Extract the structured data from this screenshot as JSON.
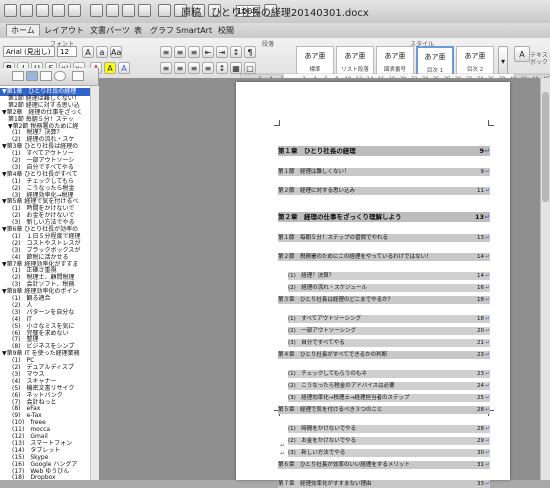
{
  "window": {
    "title": "原稿　ひとり社長の経理20140301.docx",
    "zoom": "100%"
  },
  "ribbon": {
    "tabs": [
      "ホーム",
      "レイアウト",
      "文書パーツ",
      "表",
      "グラフ",
      "SmartArt",
      "校閲"
    ],
    "active_tab": "ホーム",
    "group_labels": {
      "font": "フォント",
      "paragraph": "段落",
      "styles": "スタイル"
    },
    "font_name": "Arial (見出し)",
    "font_size": "12",
    "style_tiles": [
      {
        "preview": "あア亜",
        "label": "標準"
      },
      {
        "preview": "あア亜",
        "label": "リスト段落"
      },
      {
        "preview": "あア亜",
        "label": "図表番号"
      },
      {
        "preview": "あア亜",
        "label": "目次 1"
      },
      {
        "preview": "あア亜",
        "label": "目次 2"
      }
    ],
    "right_label": "テキスト\nボック",
    "format_buttons": [
      "B",
      "I",
      "U",
      "A",
      "A",
      "A"
    ]
  },
  "ruler": {
    "ticks": [
      "6",
      "4",
      "2",
      "",
      "2",
      "4",
      "6",
      "8",
      "10",
      "12",
      "14",
      "16",
      "18",
      "20",
      "22",
      "24",
      "26",
      "28",
      "30",
      "32",
      "34",
      "36",
      "38",
      "40",
      "42",
      "44",
      "46",
      "48"
    ]
  },
  "sidebar": {
    "items": [
      {
        "text": "▼第1章　ひとり社長の経理",
        "level": 0,
        "selected": true
      },
      {
        "text": "第1節 経理は難しくない！",
        "level": 1
      },
      {
        "text": "第2節 経理に対する思い込",
        "level": 1
      },
      {
        "text": "▼第2章　経理の仕事をざっく",
        "level": 0
      },
      {
        "text": "第1節 毎朝５分！ステッ",
        "level": 1
      },
      {
        "text": "▼第2節 税務署のために経",
        "level": 1
      },
      {
        "text": "(1)　税理？決算？",
        "level": 2
      },
      {
        "text": "(2)　経理の流れ・スケ",
        "level": 2
      },
      {
        "text": "▼第3章 ひとり社長は経理の",
        "level": 0
      },
      {
        "text": "(1)　すべてアウトソー",
        "level": 2
      },
      {
        "text": "(2)　一部アウトソーシ",
        "level": 2
      },
      {
        "text": "(3)　自分ですべてやる",
        "level": 2
      },
      {
        "text": "▼第4章 ひとり社長がすべて",
        "level": 0
      },
      {
        "text": "(1)　チェックしてもら",
        "level": 2
      },
      {
        "text": "(2)　こうなったら税金",
        "level": 2
      },
      {
        "text": "(3)　経理効率化→税理",
        "level": 2
      },
      {
        "text": "▼第5章 経理で気を付けるべ",
        "level": 0
      },
      {
        "text": "(1)　時間をかけないで",
        "level": 2
      },
      {
        "text": "(2)　お金をかけないで",
        "level": 2
      },
      {
        "text": "(3)　新しい方法でやる",
        "level": 2
      },
      {
        "text": "▼第6章 ひとり社長が効率の",
        "level": 0
      },
      {
        "text": "(1)　１日５分程度で経理",
        "level": 2
      },
      {
        "text": "(2)　コストやストレスが",
        "level": 2
      },
      {
        "text": "(3)　ブラックボックスが",
        "level": 2
      },
      {
        "text": "(4)　節税に活かせる",
        "level": 2
      },
      {
        "text": "▼第7章 経理効率化がすすま",
        "level": 0
      },
      {
        "text": "(1)　正確さ重視",
        "level": 2
      },
      {
        "text": "(2)　税理士、顧問税理",
        "level": 2
      },
      {
        "text": "(3)　会計ソフト、税務",
        "level": 2
      },
      {
        "text": "▼第8章 経理効率化のポイン",
        "level": 0
      },
      {
        "text": "(1)　観る適合",
        "level": 2
      },
      {
        "text": "(2)　人",
        "level": 2
      },
      {
        "text": "(3)　パターンを自分な",
        "level": 2
      },
      {
        "text": "(4)　IT",
        "level": 2
      },
      {
        "text": "(5)　小さなミスを気に",
        "level": 2
      },
      {
        "text": "(6)　完璧を求めない",
        "level": 2
      },
      {
        "text": "(7)　整理",
        "level": 2
      },
      {
        "text": "(8)　ビジネスをシンプ",
        "level": 2
      },
      {
        "text": "▼第9章 IT を使った経理業務",
        "level": 0
      },
      {
        "text": "(1)　PC",
        "level": 2
      },
      {
        "text": "(2)　デュアルディスプ",
        "level": 2
      },
      {
        "text": "(3)　マウス",
        "level": 2
      },
      {
        "text": "(4)　スキャナー",
        "level": 2
      },
      {
        "text": "(5)　機密文書リサイク",
        "level": 2
      },
      {
        "text": "(6)　ネットバンク",
        "level": 2
      },
      {
        "text": "(7)　会計ねっと",
        "level": 2
      },
      {
        "text": "(8)　eFax",
        "level": 2
      },
      {
        "text": "(9)　e-Tax",
        "level": 2
      },
      {
        "text": "(10)　freee",
        "level": 2
      },
      {
        "text": "(11)　mocca",
        "level": 2
      },
      {
        "text": "(12)　Gmail",
        "level": 2
      },
      {
        "text": "(13)　スマートフォン",
        "level": 2
      },
      {
        "text": "(14)　タブレット",
        "level": 2
      },
      {
        "text": "(15)　Skype",
        "level": 2
      },
      {
        "text": "(16)　Google ハングア",
        "level": 2
      },
      {
        "text": "(17)　Web ゆうびん",
        "level": 2
      },
      {
        "text": "(18)　Dropbox",
        "level": 2
      }
    ]
  },
  "toc": [
    {
      "text": "第１章　ひとり社長の経理",
      "page": "9",
      "kind": "ch"
    },
    {
      "text": "第１節　経理は難しくない！",
      "page": "9",
      "kind": "sec"
    },
    {
      "text": "第２節　経理に対する思い込み",
      "page": "11",
      "kind": "sec"
    },
    {
      "text": "第２章　経理の仕事をざっくり理解しよう",
      "page": "13",
      "kind": "ch"
    },
    {
      "text": "第１節　毎朝５分！ステップの習慣でやれる",
      "page": "13",
      "kind": "sec"
    },
    {
      "text": "第２節　税務署のためにこの経理をやっているわけではない！",
      "page": "14",
      "kind": "sec"
    },
    {
      "text": "(1)　経理？決算？",
      "page": "14",
      "kind": "sub"
    },
    {
      "text": "(2)　経理の流れ・スケジュール",
      "page": "16",
      "kind": "sub"
    },
    {
      "text": "第３章　ひとり社長は経理のどこまでやるか？",
      "page": "18",
      "kind": "sec"
    },
    {
      "text": "(1)　すべてアウトソーシング",
      "page": "18",
      "kind": "sub"
    },
    {
      "text": "(2)　一部アウトソーシング",
      "page": "20",
      "kind": "sub"
    },
    {
      "text": "(3)　自分ですべてやる",
      "page": "21",
      "kind": "sub"
    },
    {
      "text": "第４章　ひとり社長がすべてできるかの判断",
      "page": "23",
      "kind": "sec"
    },
    {
      "text": "(1)　チェックしてもらうのもネ",
      "page": "23",
      "kind": "sub"
    },
    {
      "text": "(2)　こうなったら税金のアドバイスは必要",
      "page": "24",
      "kind": "sub"
    },
    {
      "text": "(3)　経理効率化→税理士→経理担当者のステップ",
      "page": "25",
      "kind": "sub"
    },
    {
      "text": "第５章　経理で気を付けるべき３つのこと",
      "page": "28",
      "kind": "sec"
    },
    {
      "text": "(1)　時間をかけないでやる",
      "page": "28",
      "kind": "sub"
    },
    {
      "text": "(2)　お金をかけないでやる",
      "page": "29",
      "kind": "sub"
    },
    {
      "text": "(3)　新しい方法でやる",
      "page": "30",
      "kind": "sub"
    },
    {
      "text": "第６章　ひとり社長が効率のいい経理をするメリット",
      "page": "31",
      "kind": "sec"
    },
    {
      "text": "第７章　経理効率化がすすまない理由",
      "page": "33",
      "kind": "sec"
    }
  ]
}
